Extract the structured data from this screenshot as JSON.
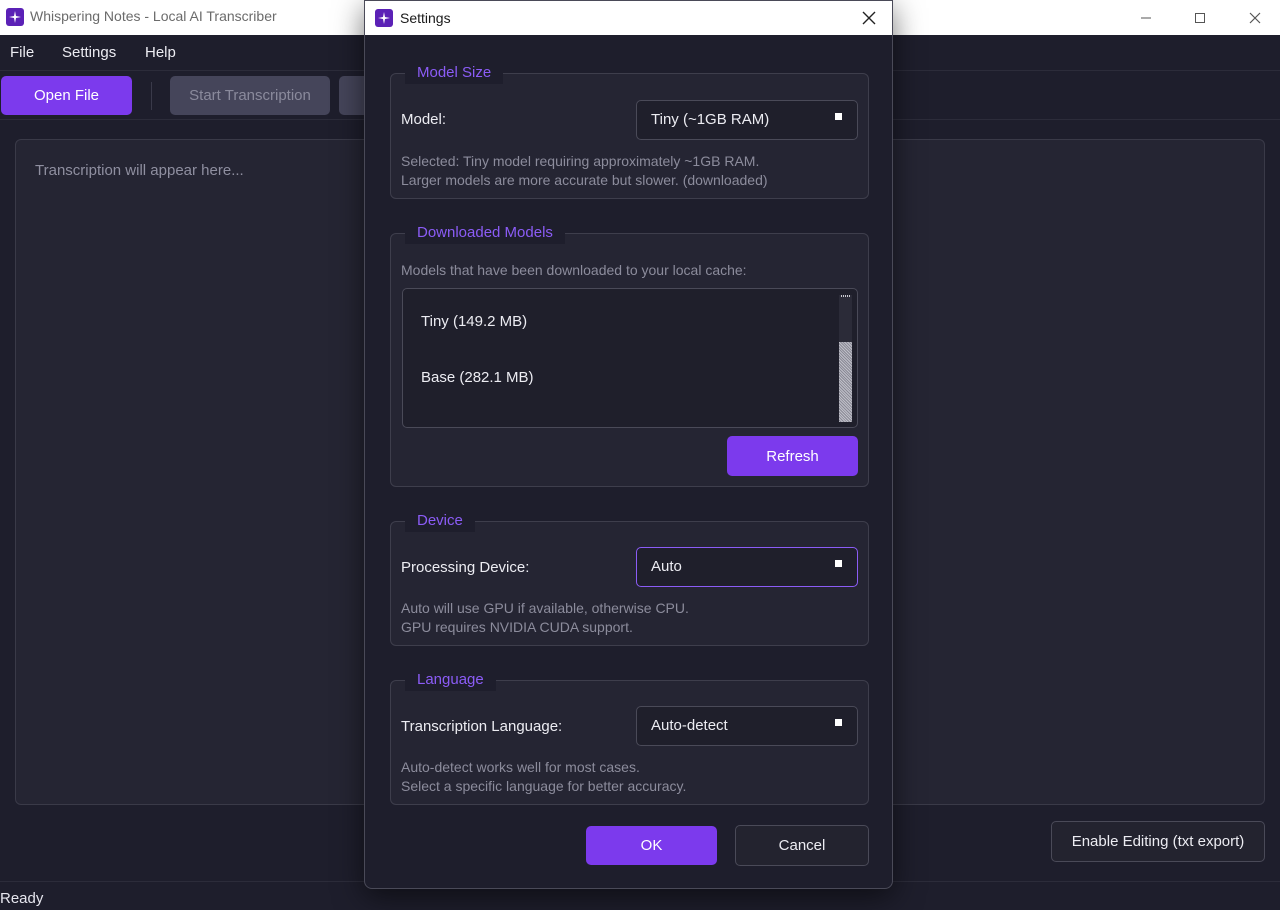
{
  "app": {
    "window_title": "Whispering Notes - Local AI Transcriber",
    "menu": [
      "File",
      "Settings",
      "Help"
    ],
    "toolbar": {
      "open_file": "Open File",
      "start_transcription": "Start Transcription"
    },
    "transcript_placeholder": "Transcription will appear here...",
    "enable_editing": "Enable Editing (txt export)",
    "status": "Ready"
  },
  "dialog": {
    "title": "Settings",
    "model_size": {
      "title": "Model Size",
      "label": "Model:",
      "value": "Tiny (~1GB RAM)",
      "help_line1": "Selected: Tiny model requiring approximately ~1GB RAM.",
      "help_line2": "Larger models are more accurate but slower. (downloaded)"
    },
    "downloaded_models": {
      "title": "Downloaded Models",
      "description": "Models that have been downloaded to your local cache:",
      "items": [
        "Tiny (149.2 MB)",
        "Base (282.1 MB)"
      ],
      "refresh": "Refresh"
    },
    "device": {
      "title": "Device",
      "label": "Processing Device:",
      "value": "Auto",
      "help_line1": "Auto will use GPU if available, otherwise CPU.",
      "help_line2": "GPU requires NVIDIA CUDA support."
    },
    "language": {
      "title": "Language",
      "label": "Transcription Language:",
      "value": "Auto-detect",
      "help_line1": "Auto-detect works well for most cases.",
      "help_line2": "Select a specific language for better accuracy."
    },
    "ok": "OK",
    "cancel": "Cancel"
  },
  "colors": {
    "accent": "#7c3aed",
    "group_title": "#8b5cf6",
    "background": "#1e1e2c"
  }
}
